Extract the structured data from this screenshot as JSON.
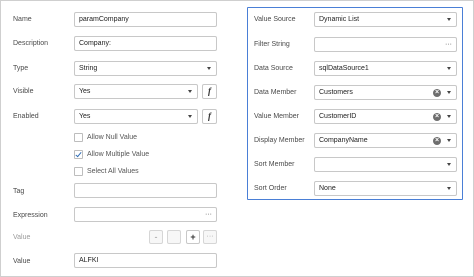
{
  "left": {
    "name": {
      "label": "Name",
      "value": "paramCompany"
    },
    "description": {
      "label": "Description",
      "value": "Company:"
    },
    "type": {
      "label": "Type",
      "value": "String"
    },
    "visible": {
      "label": "Visible",
      "value": "Yes"
    },
    "enabled": {
      "label": "Enabled",
      "value": "Yes"
    },
    "checkboxes": [
      {
        "label": "Allow Null Value",
        "checked": false
      },
      {
        "label": "Allow Multiple Value",
        "checked": true
      },
      {
        "label": "Select All Values",
        "checked": false
      }
    ],
    "tag": {
      "label": "Tag",
      "value": ""
    },
    "expression": {
      "label": "Expression",
      "value": "",
      "ellipsis": "···"
    },
    "value_editor": {
      "label": "Value",
      "minus": "-",
      "plus": "+",
      "more": "···"
    },
    "value": {
      "label": "Value",
      "value": "ALFKI"
    },
    "function_button_label": "f"
  },
  "right": {
    "value_source": {
      "label": "Value Source",
      "value": "Dynamic List"
    },
    "filter_string": {
      "label": "Filter String",
      "value": "",
      "ellipsis": "···"
    },
    "data_source": {
      "label": "Data Source",
      "value": "sqlDataSource1"
    },
    "data_member": {
      "label": "Data Member",
      "value": "Customers"
    },
    "value_member": {
      "label": "Value Member",
      "value": "CustomerID"
    },
    "display_member": {
      "label": "Display Member",
      "value": "CompanyName"
    },
    "sort_member": {
      "label": "Sort Member",
      "value": ""
    },
    "sort_order": {
      "label": "Sort Order",
      "value": "None"
    },
    "clear_glyph": "×"
  },
  "colors": {
    "accent_border": "#4a7fd6",
    "check_mark": "#2f6db6"
  }
}
